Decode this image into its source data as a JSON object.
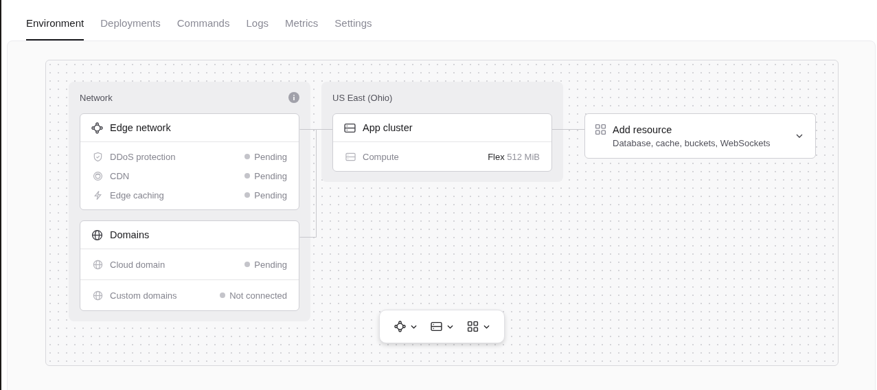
{
  "tabs": [
    {
      "label": "Environment",
      "selected": true
    },
    {
      "label": "Deployments",
      "selected": false
    },
    {
      "label": "Commands",
      "selected": false
    },
    {
      "label": "Logs",
      "selected": false
    },
    {
      "label": "Metrics",
      "selected": false
    },
    {
      "label": "Settings",
      "selected": false
    }
  ],
  "groups": [
    {
      "title": "Network",
      "info": true,
      "cards": [
        {
          "title": "Edge network",
          "divided": false,
          "rows": [
            {
              "kind": "status",
              "label": "DDoS protection",
              "status": "Pending"
            },
            {
              "kind": "status",
              "label": "CDN",
              "status": "Pending"
            },
            {
              "kind": "status",
              "label": "Edge caching",
              "status": "Pending"
            }
          ]
        },
        {
          "title": "Domains",
          "divided": true,
          "rows": [
            {
              "kind": "status",
              "label": "Cloud domain",
              "status": "Pending"
            },
            {
              "kind": "status",
              "label": "Custom domains",
              "status": "Not connected"
            }
          ]
        }
      ]
    },
    {
      "title": "US East (Ohio)",
      "info": false,
      "cards": [
        {
          "title": "App cluster",
          "divided": false,
          "rows": [
            {
              "kind": "spec",
              "label": "Compute",
              "plan": "Flex",
              "size": "512 MiB"
            }
          ]
        }
      ]
    }
  ],
  "add_resource": {
    "title": "Add resource",
    "subtitle": "Database, cache, buckets, WebSockets"
  }
}
